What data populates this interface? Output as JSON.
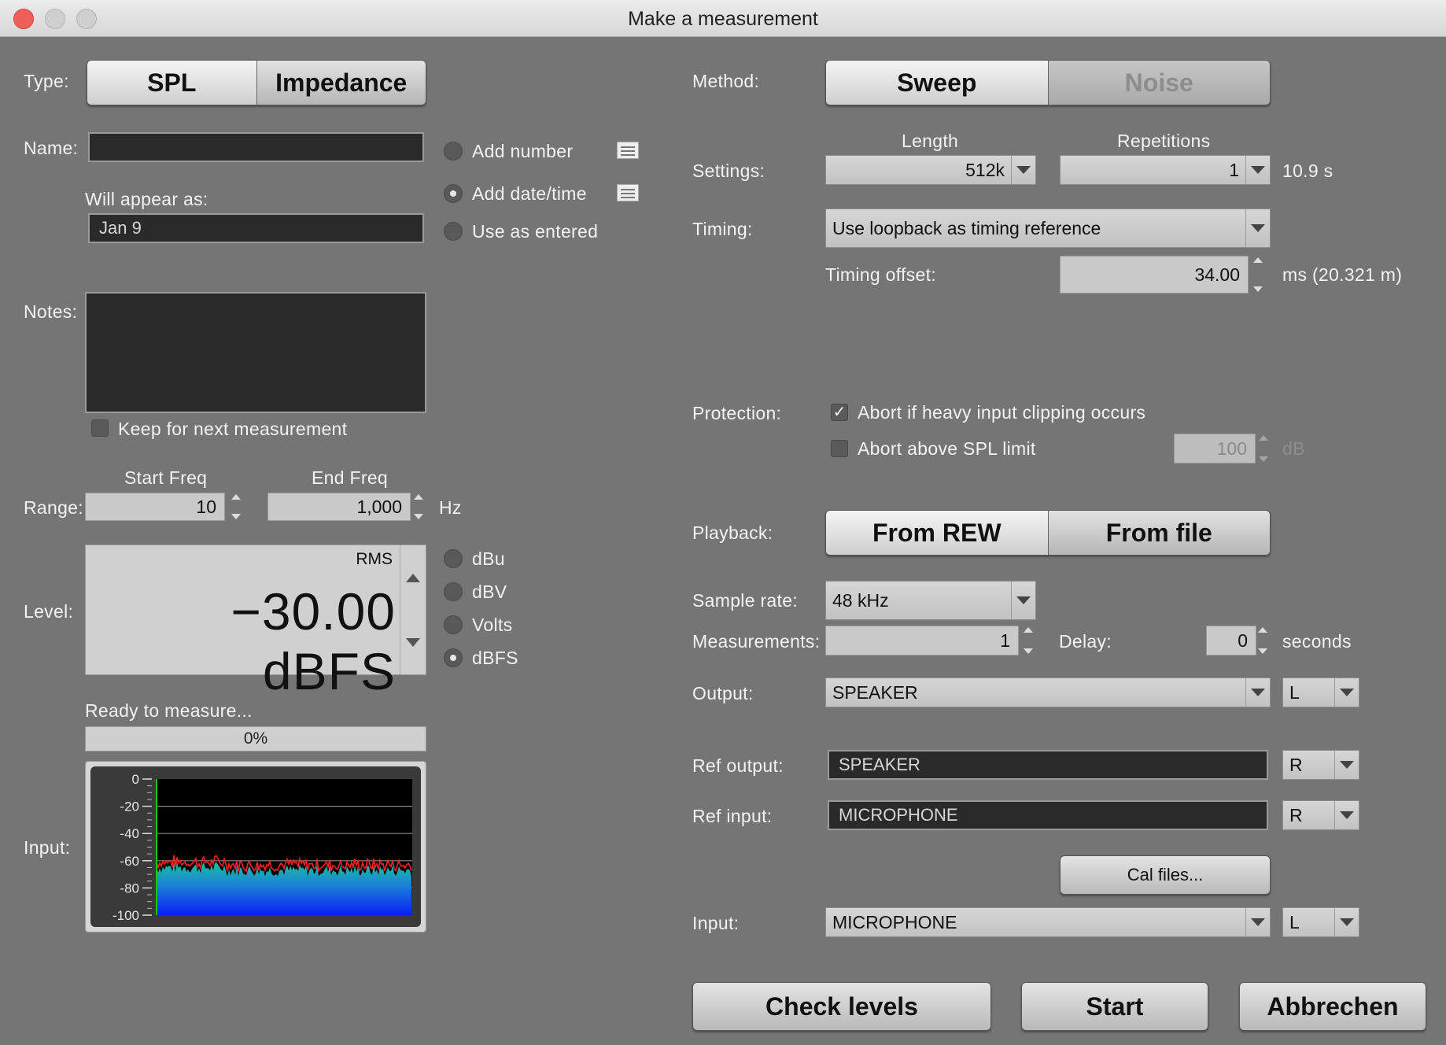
{
  "window": {
    "title": "Make a measurement"
  },
  "left": {
    "type_label": "Type:",
    "type_options": [
      "SPL",
      "Impedance"
    ],
    "name_label": "Name:",
    "name_value": "",
    "name_options": [
      "Add number",
      "Add date/time",
      "Use as entered"
    ],
    "will_appear_label": "Will appear as:",
    "will_appear_value": "Jan 9",
    "notes_label": "Notes:",
    "notes_value": "",
    "keep_label": "Keep for next measurement",
    "range_label": "Range:",
    "start_freq_label": "Start Freq",
    "start_freq_value": "10",
    "end_freq_label": "End Freq",
    "end_freq_value": "1,000",
    "hz_label": "Hz",
    "level_label": "Level:",
    "level_mode": "RMS",
    "level_value": "−30.00 dBFS",
    "level_units": [
      "dBu",
      "dBV",
      "Volts",
      "dBFS"
    ],
    "status_text": "Ready to measure...",
    "progress_text": "0%",
    "progress_value": 0,
    "input_label": "Input:",
    "meter_ticks": [
      "0",
      "-20",
      "-40",
      "-60",
      "-80",
      "-100"
    ]
  },
  "right": {
    "method_label": "Method:",
    "method_options": [
      "Sweep",
      "Noise"
    ],
    "settings_label": "Settings:",
    "length_label": "Length",
    "length_value": "512k",
    "repetitions_label": "Repetitions",
    "repetitions_value": "1",
    "duration_text": "10.9 s",
    "timing_label": "Timing:",
    "timing_value": "Use loopback as timing reference",
    "timing_offset_label": "Timing offset:",
    "timing_offset_value": "34.00",
    "timing_offset_unit": "ms (20.321 m)",
    "protection_label": "Protection:",
    "abort_clipping_label": "Abort if heavy input clipping occurs",
    "abort_spl_label": "Abort above SPL limit",
    "spl_limit_value": "100",
    "spl_limit_unit": "dB",
    "playback_label": "Playback:",
    "playback_options": [
      "From REW",
      "From file"
    ],
    "sample_rate_label": "Sample rate:",
    "sample_rate_value": "48 kHz",
    "measurements_label": "Measurements:",
    "measurements_value": "1",
    "delay_label": "Delay:",
    "delay_value": "0",
    "delay_unit": "seconds",
    "output_label": "Output:",
    "output_value": "SPEAKER",
    "output_channel": "L",
    "ref_output_label": "Ref output:",
    "ref_output_value": "SPEAKER",
    "ref_output_channel": "R",
    "ref_input_label": "Ref input:",
    "ref_input_value": "MICROPHONE",
    "ref_input_channel": "R",
    "cal_files_label": "Cal files...",
    "input_label": "Input:",
    "input_value": "MICROPHONE",
    "input_channel": "L"
  },
  "buttons": {
    "check_levels": "Check levels",
    "start": "Start",
    "cancel": "Abbrechen"
  }
}
